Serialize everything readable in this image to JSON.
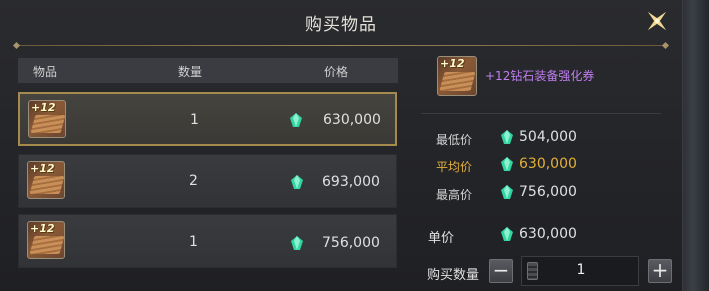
{
  "dialog": {
    "title": "购买物品"
  },
  "list": {
    "headers": {
      "item": "物品",
      "quantity": "数量",
      "price": "价格"
    },
    "rows": [
      {
        "icon_label": "+12",
        "quantity": "1",
        "price": "630,000",
        "selected": true
      },
      {
        "icon_label": "+12",
        "quantity": "2",
        "price": "693,000",
        "selected": false
      },
      {
        "icon_label": "+12",
        "quantity": "1",
        "price": "756,000",
        "selected": false
      }
    ]
  },
  "info": {
    "icon_label": "+12",
    "item_name": "+12钻石装备强化券",
    "stats": [
      {
        "label": "最低价",
        "value": "504,000",
        "highlight": false
      },
      {
        "label": "平均价",
        "value": "630,000",
        "highlight": true
      },
      {
        "label": "最高价",
        "value": "756,000",
        "highlight": false
      }
    ],
    "unit_price_label": "单价",
    "unit_price_value": "630,000"
  },
  "purchase": {
    "quantity_label": "购买数量",
    "quantity_value": "1",
    "minus": "−",
    "plus": "+"
  },
  "icons": {
    "close": "close-icon",
    "currency": "green-gem-icon",
    "calculator": "calculator-icon"
  },
  "colors": {
    "accent_gold": "#e3b13a",
    "item_name_purple": "#c07ef0",
    "gem_green": "#2fd6a0",
    "selected_border": "#a48a4c"
  }
}
